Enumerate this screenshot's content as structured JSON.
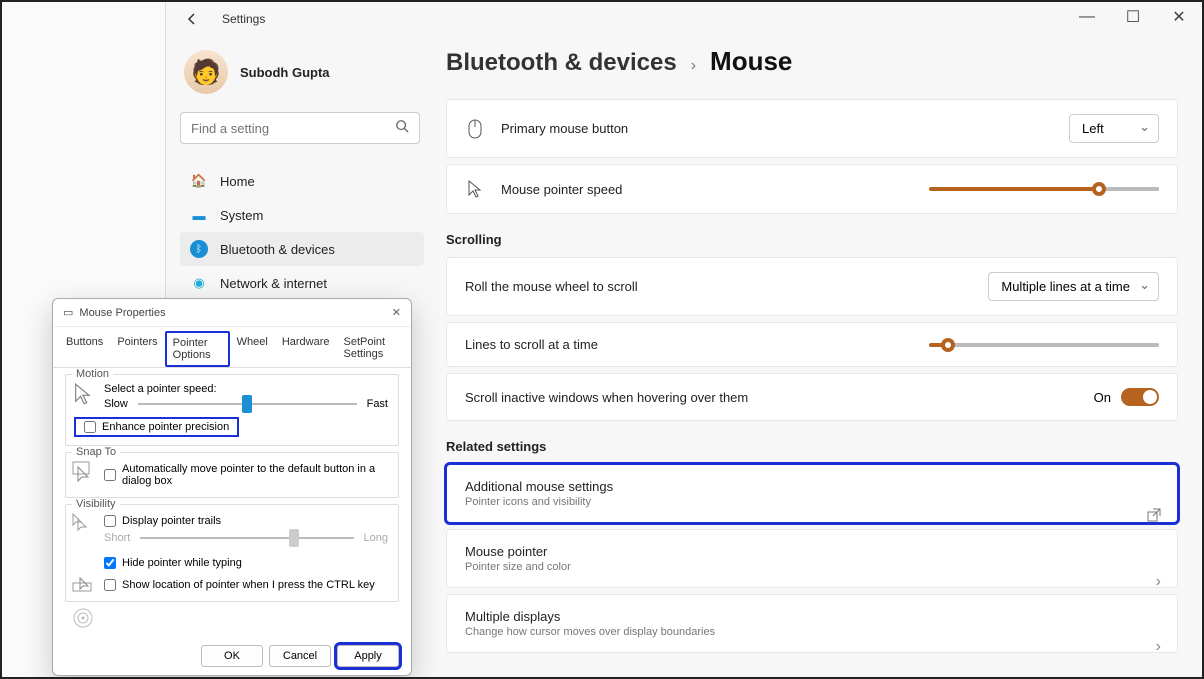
{
  "window": {
    "title": "Settings",
    "minimize": "—",
    "maximize": "☐",
    "close": "✕"
  },
  "user": {
    "name": "Subodh Gupta"
  },
  "search": {
    "placeholder": "Find a setting"
  },
  "nav": [
    {
      "icon": "home",
      "label": "Home"
    },
    {
      "icon": "system",
      "label": "System"
    },
    {
      "icon": "bt",
      "label": "Bluetooth & devices"
    },
    {
      "icon": "wifi",
      "label": "Network & internet"
    }
  ],
  "breadcrumb": {
    "parent": "Bluetooth & devices",
    "current": "Mouse"
  },
  "primaryButton": {
    "label": "Primary mouse button",
    "value": "Left"
  },
  "pointerSpeed": {
    "label": "Mouse pointer speed"
  },
  "sections": {
    "scrolling": "Scrolling",
    "related": "Related settings"
  },
  "scrollWheel": {
    "label": "Roll the mouse wheel to scroll",
    "value": "Multiple lines at a time"
  },
  "linesScroll": {
    "label": "Lines to scroll at a time"
  },
  "scrollInactive": {
    "label": "Scroll inactive windows when hovering over them",
    "state": "On"
  },
  "related": {
    "additional": {
      "title": "Additional mouse settings",
      "sub": "Pointer icons and visibility"
    },
    "mousePointer": {
      "title": "Mouse pointer",
      "sub": "Pointer size and color"
    },
    "multiDisplay": {
      "title": "Multiple displays",
      "sub": "Change how cursor moves over display boundaries"
    }
  },
  "dialog": {
    "title": "Mouse Properties",
    "tabs": [
      "Buttons",
      "Pointers",
      "Pointer Options",
      "Wheel",
      "Hardware",
      "SetPoint Settings"
    ],
    "motion": {
      "legend": "Motion",
      "selectSpeed": "Select a pointer speed:",
      "slow": "Slow",
      "fast": "Fast",
      "enhance": "Enhance pointer precision"
    },
    "snap": {
      "legend": "Snap To",
      "auto": "Automatically move pointer to the default button in a dialog box"
    },
    "visibility": {
      "legend": "Visibility",
      "trails": "Display pointer trails",
      "short": "Short",
      "long": "Long",
      "hide": "Hide pointer while typing",
      "ctrl": "Show location of pointer when I press the CTRL key"
    },
    "buttons": {
      "ok": "OK",
      "cancel": "Cancel",
      "apply": "Apply"
    }
  }
}
